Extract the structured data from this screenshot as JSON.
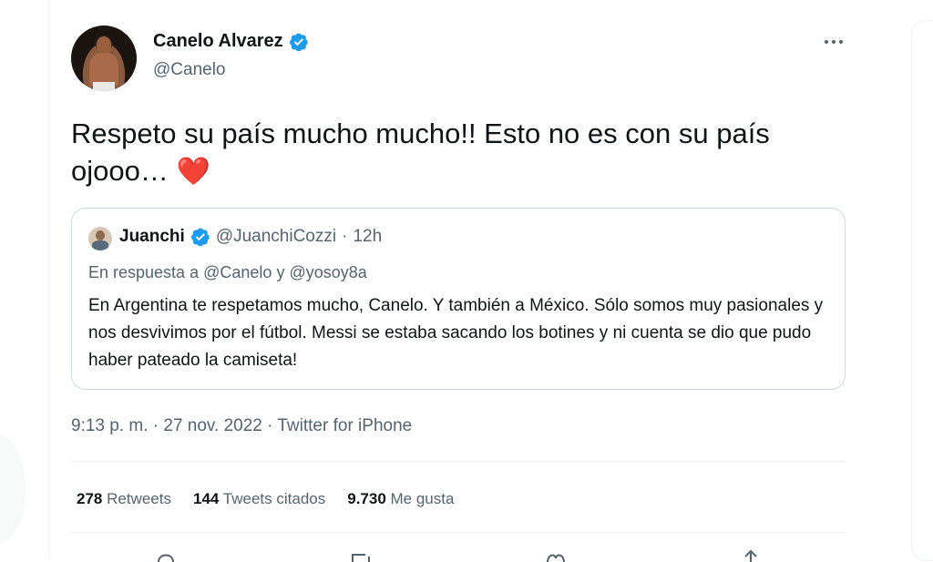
{
  "tweet": {
    "author": {
      "name": "Canelo Alvarez",
      "handle": "@Canelo",
      "verified": true
    },
    "text_line1": "Respeto su país mucho mucho!! Esto no es con su país",
    "text_line2": "ojooo…",
    "emoji": "❤️",
    "quoted": {
      "name": "Juanchi",
      "handle": "@JuanchiCozzi",
      "separator": "·",
      "time": "12h",
      "reply_prefix": "En respuesta a",
      "reply_to_1": "@Canelo",
      "reply_conj": "y",
      "reply_to_2": "@yosoy8a",
      "body": "En Argentina te respetamos mucho, Canelo. Y también a México. Sólo somos muy pasionales y nos desvivimos por el fútbol. Messi se estaba sacando los botines y ni cuenta se dio que pudo haber pateado la camiseta!"
    },
    "meta": "9:13 p. m. · 27 nov. 2022 · Twitter for iPhone",
    "stats": {
      "retweets_count": "278",
      "retweets_label": "Retweets",
      "quotes_count": "144",
      "quotes_label": "Tweets citados",
      "likes_count": "9.730",
      "likes_label": "Me gusta"
    }
  },
  "colors": {
    "verified": "#1d9bf0",
    "heart": "#e0245e",
    "secondary_text": "#536471"
  }
}
